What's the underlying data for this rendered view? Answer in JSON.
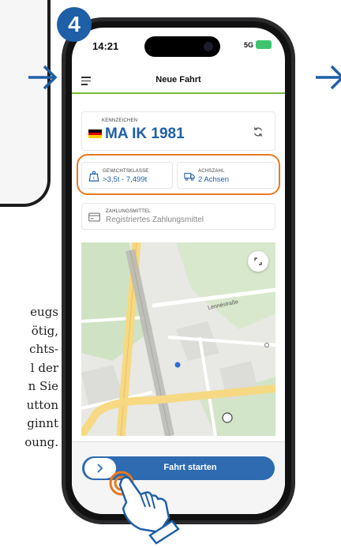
{
  "step": {
    "number": "4"
  },
  "instructions": {
    "lines": [
      "eugs",
      "ötig,",
      "chts-",
      "l der",
      "n Sie",
      "utton",
      "ginnt",
      "oung."
    ]
  },
  "status_bar": {
    "time": "14:21",
    "network": "5G"
  },
  "nav": {
    "title": "Neue Fahrt"
  },
  "vehicle": {
    "plate_label": "KENNZEICHEN",
    "plate": "MA IK 1981",
    "weight_label": "GEWICHTSKLASSE",
    "weight": ">3,5t - 7,499t",
    "axle_label": "ACHSZAHL",
    "axles": "2 Achsen"
  },
  "payment": {
    "label": "ZAHLUNGSMITTEL",
    "value": "Registriertes Zahlungsmittel"
  },
  "map": {
    "street": "Lennéstraße"
  },
  "action": {
    "start_label": "Fahrt starten"
  },
  "colors": {
    "brand_blue": "#1f5fa8",
    "accent_green": "#7dbb3a",
    "highlight_orange": "#e87a1e",
    "button_blue": "#2e6bb0"
  },
  "icons": [
    "menu-icon",
    "refresh-icon",
    "weight-icon",
    "truck-icon",
    "credit-card-icon",
    "expand-icon",
    "location-dot-icon",
    "chevron-right-icon",
    "tap-hand-icon",
    "arrow-right-icon"
  ]
}
